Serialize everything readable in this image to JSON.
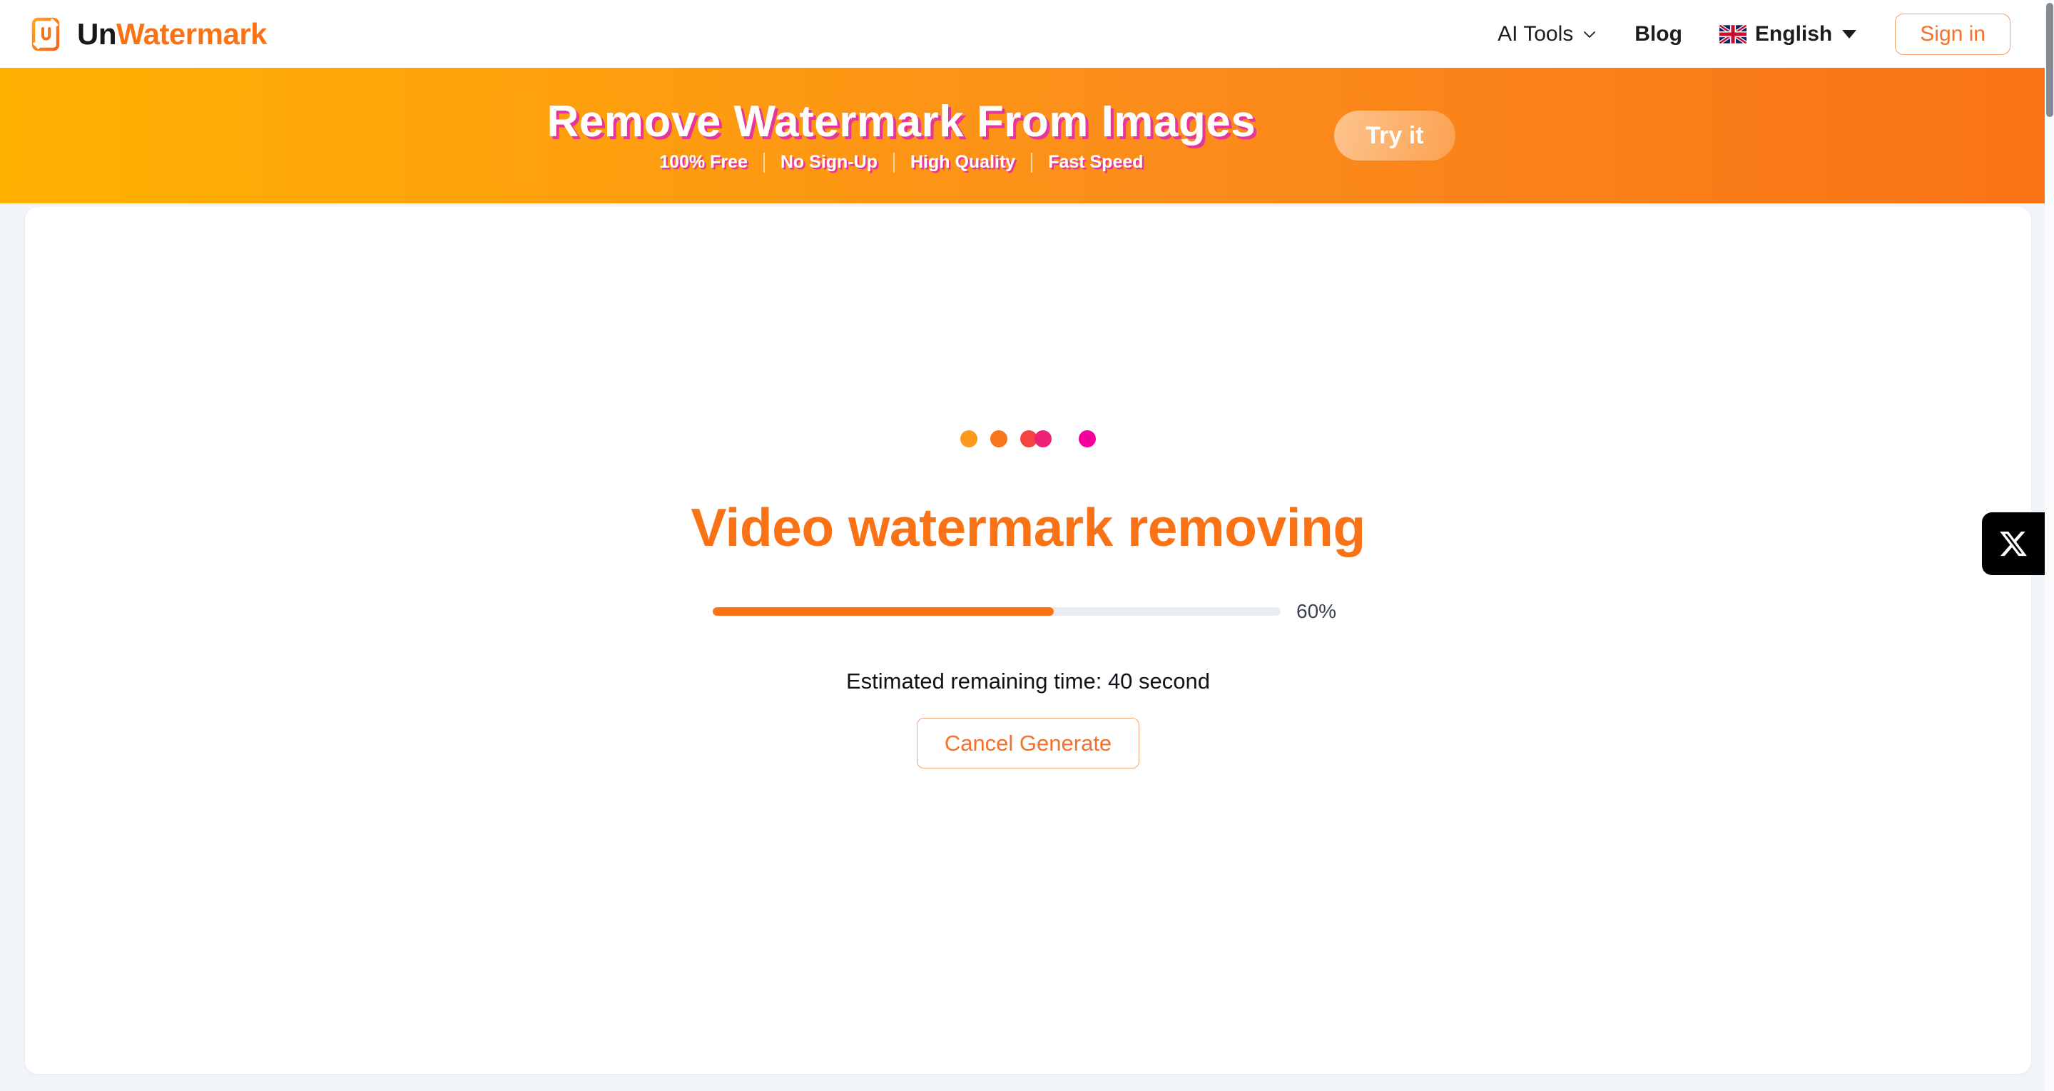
{
  "header": {
    "logo": {
      "icon": "unwatermark-logo-icon",
      "text_dark": "Un",
      "text_accent": "Watermark"
    },
    "nav": [
      {
        "label": "AI Tools",
        "icon": "chevron-down-icon",
        "bold": false
      },
      {
        "label": "Blog",
        "bold": true
      }
    ],
    "language": {
      "label": "English",
      "flag": "uk-flag-icon",
      "caret": "caret-down-icon"
    },
    "sign_in_label": "Sign in"
  },
  "banner": {
    "title": "Remove Watermark From Images",
    "features": [
      "100% Free",
      "No Sign-Up",
      "High Quality",
      "Fast Speed"
    ],
    "cta_label": "Try it",
    "gradient_start": "#ffb100",
    "gradient_end": "#f97316"
  },
  "main": {
    "loader": {
      "name": "loading-dots",
      "dot_colors": [
        "#fb9a1d",
        "#f7761a",
        "#f5443f",
        "#ee2277",
        "#f5009b"
      ]
    },
    "status_title": "Video watermark removing",
    "status_title_color": "#f97316",
    "progress": {
      "percent": 60,
      "label": "60%",
      "fill_color": "#f97316",
      "track_color": "#e9ecf3"
    },
    "estimated_time": "Estimated remaining time: 40 second",
    "cancel_label": "Cancel Generate"
  },
  "side_widget": {
    "name": "x-share-widget",
    "icon": "x-twitter-icon",
    "background": "#000000"
  },
  "scrollbar": {
    "thumb_color": "#868a91"
  }
}
